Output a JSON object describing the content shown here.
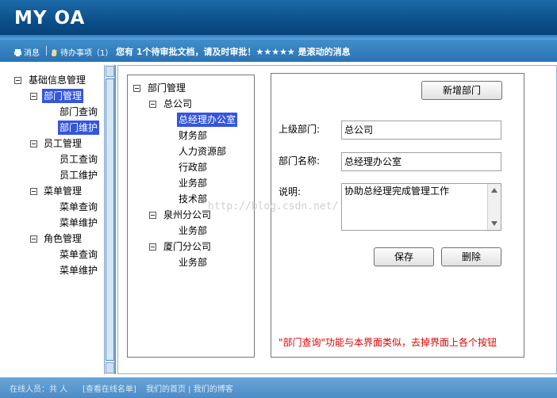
{
  "header": {
    "title": "MY OA"
  },
  "notify": {
    "messages_label": "消息",
    "todo_label": "待办事项（1）",
    "scroll_message": "您有 1个待审批文档，请及时审批！★★★★★ 是滚动的消息"
  },
  "left_tree": [
    {
      "label": "基础信息管理",
      "toggle": true
    },
    {
      "label": "部门管理",
      "toggle": true,
      "selected": true
    },
    {
      "label": "部门查询"
    },
    {
      "label": "部门维护",
      "selected": true
    },
    {
      "label": "员工管理",
      "toggle": true
    },
    {
      "label": "员工查询"
    },
    {
      "label": "员工维护"
    },
    {
      "label": "菜单管理",
      "toggle": true
    },
    {
      "label": "菜单查询"
    },
    {
      "label": "菜单维护"
    },
    {
      "label": "角色管理",
      "toggle": true
    },
    {
      "label": "菜单查询"
    },
    {
      "label": "菜单维护"
    }
  ],
  "dept_tree": [
    {
      "label": "部门管理",
      "toggle": true
    },
    {
      "label": "总公司",
      "toggle": true
    },
    {
      "label": "总经理办公室",
      "selected": true
    },
    {
      "label": "财务部"
    },
    {
      "label": "人力资源部"
    },
    {
      "label": "行政部"
    },
    {
      "label": "业务部"
    },
    {
      "label": "技术部"
    },
    {
      "label": "泉州分公司",
      "toggle": true
    },
    {
      "label": "业务部"
    },
    {
      "label": "厦门分公司",
      "toggle": true
    },
    {
      "label": "业务部"
    }
  ],
  "form": {
    "add_button": "新增部门",
    "parent_label": "上级部门:",
    "parent_value": "总公司",
    "name_label": "部门名称:",
    "name_value": "总经理办公室",
    "desc_label": "说明:",
    "desc_value": "协助总经理完成管理工作",
    "save_button": "保存",
    "delete_button": "删除",
    "note": "\"部门查询\"功能与本界面类似，去掉界面上各个按钮"
  },
  "watermark": "http://blog.csdn.net/",
  "footer": {
    "online": "在线人员：共 人",
    "view_online": "[查看在线名单]",
    "home_blog": "我们的首页 | 我们的博客"
  },
  "colors": {
    "header": "#0b4e89",
    "selection": "#3355e0",
    "note": "#e00000"
  }
}
